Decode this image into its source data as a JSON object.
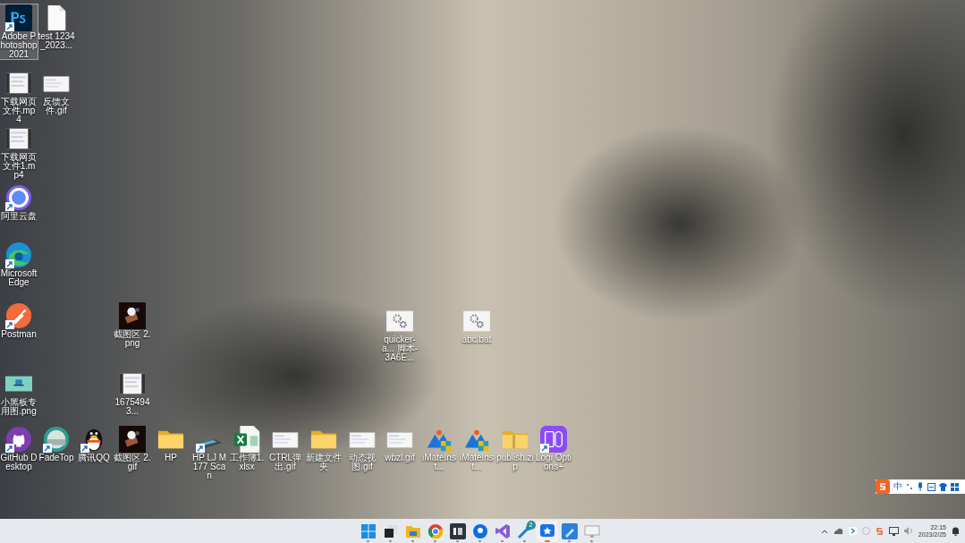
{
  "desktop_icons": [
    {
      "label": "Adobe Photoshop 2021",
      "kind": "photoshop",
      "shortcut": true,
      "selected": true
    },
    {
      "label": "test 1234_2023...",
      "kind": "document",
      "shortcut": false,
      "selected": false
    },
    {
      "label": "下载网页文件.mp4",
      "kind": "video",
      "shortcut": false,
      "selected": false
    },
    {
      "label": "反馈文件.gif",
      "kind": "image",
      "shortcut": false,
      "selected": false
    },
    {
      "label": "下载网页文件1.mp4",
      "kind": "video",
      "shortcut": false,
      "selected": false
    },
    {
      "label": "阿里云盘",
      "kind": "aliyun",
      "shortcut": true,
      "selected": false
    },
    {
      "label": "Microsoft Edge",
      "kind": "edge",
      "shortcut": true,
      "selected": false
    },
    {
      "label": "Postman",
      "kind": "postman",
      "shortcut": true,
      "selected": false
    },
    {
      "label": "截图区 2.png",
      "kind": "sticker",
      "shortcut": false,
      "selected": false
    },
    {
      "label": "quicker-a... 脚本-3A6E...",
      "kind": "gear",
      "shortcut": false,
      "selected": false
    },
    {
      "label": "abc.bat",
      "kind": "gear",
      "shortcut": false,
      "selected": false
    },
    {
      "label": "小黑板专用图.png",
      "kind": "teal-image",
      "shortcut": false,
      "selected": false
    },
    {
      "label": "16754943...",
      "kind": "video",
      "shortcut": false,
      "selected": false
    },
    {
      "label": "GitHub Desktop",
      "kind": "github",
      "shortcut": true,
      "selected": false
    },
    {
      "label": "FadeTop",
      "kind": "fadetop",
      "shortcut": true,
      "selected": false
    },
    {
      "label": "腾讯QQ",
      "kind": "qq",
      "shortcut": true,
      "selected": false
    },
    {
      "label": "截图区 2.gif",
      "kind": "sticker",
      "shortcut": false,
      "selected": false
    },
    {
      "label": "HP",
      "kind": "folder",
      "shortcut": false,
      "selected": false
    },
    {
      "label": "HP LJ M177 Scan",
      "kind": "scanner",
      "shortcut": true,
      "selected": false
    },
    {
      "label": "工作簿1.xlsx",
      "kind": "excel",
      "shortcut": false,
      "selected": false
    },
    {
      "label": "CTRL弹出.gif",
      "kind": "image",
      "shortcut": false,
      "selected": false
    },
    {
      "label": "新建文件夹",
      "kind": "folder",
      "shortcut": false,
      "selected": false
    },
    {
      "label": "动态视图.gif",
      "kind": "image",
      "shortcut": false,
      "selected": false
    },
    {
      "label": "wbzl.gif",
      "kind": "image",
      "shortcut": false,
      "selected": false
    },
    {
      "label": "iMateInst...",
      "kind": "imate",
      "shortcut": false,
      "selected": false
    },
    {
      "label": "iMateInst...",
      "kind": "imate",
      "shortcut": false,
      "selected": false
    },
    {
      "label": "publish.zip",
      "kind": "zip",
      "shortcut": false,
      "selected": false
    },
    {
      "label": "Logi Options+",
      "kind": "logi",
      "shortcut": true,
      "selected": false
    }
  ],
  "ime_bar": {
    "mode": "中"
  },
  "taskbar": {
    "apps": [
      {
        "kind": "windows",
        "selected": false
      },
      {
        "kind": "taskview",
        "selected": false
      },
      {
        "kind": "explorer",
        "selected": false
      },
      {
        "kind": "chrome",
        "selected": false
      },
      {
        "kind": "mr",
        "selected": false
      },
      {
        "kind": "bluebubble",
        "selected": false
      },
      {
        "kind": "vs",
        "selected": false
      },
      {
        "kind": "steam",
        "selected": false,
        "badge": "2"
      },
      {
        "kind": "star",
        "selected": true
      },
      {
        "kind": "draw",
        "selected": false
      },
      {
        "kind": "monitor",
        "selected": false
      }
    ],
    "clock": {
      "time": "22:15",
      "date": "2023/2/25"
    }
  }
}
